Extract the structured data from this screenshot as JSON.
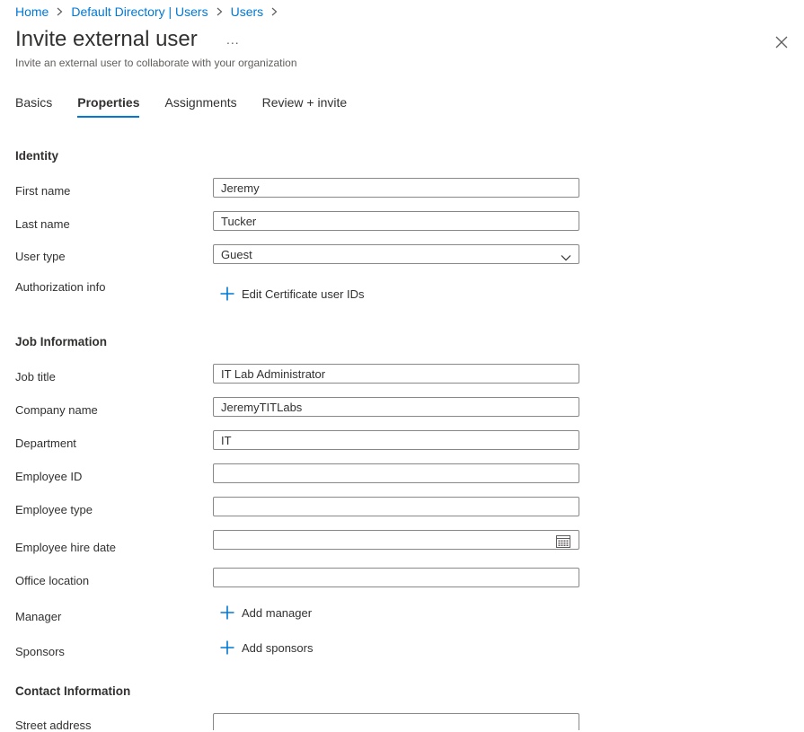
{
  "breadcrumb": {
    "items": [
      "Home",
      "Default Directory | Users",
      "Users"
    ]
  },
  "header": {
    "title": "Invite external user",
    "more_label": "...",
    "subtitle": "Invite an external user to collaborate with your organization"
  },
  "tabs": [
    {
      "label": "Basics",
      "active": false
    },
    {
      "label": "Properties",
      "active": true
    },
    {
      "label": "Assignments",
      "active": false
    },
    {
      "label": "Review + invite",
      "active": false
    }
  ],
  "identity": {
    "heading": "Identity",
    "first_name": {
      "label": "First name",
      "value": "Jeremy"
    },
    "last_name": {
      "label": "Last name",
      "value": "Tucker"
    },
    "user_type": {
      "label": "User type",
      "value": "Guest"
    },
    "authorization_info": {
      "label": "Authorization info",
      "action": "Edit Certificate user IDs"
    }
  },
  "job": {
    "heading": "Job Information",
    "job_title": {
      "label": "Job title",
      "value": "IT Lab Administrator"
    },
    "company_name": {
      "label": "Company name",
      "value": "JeremyTITLabs"
    },
    "department": {
      "label": "Department",
      "value": "IT"
    },
    "employee_id": {
      "label": "Employee ID",
      "value": ""
    },
    "employee_type": {
      "label": "Employee type",
      "value": ""
    },
    "hire_date": {
      "label": "Employee hire date",
      "value": ""
    },
    "office_location": {
      "label": "Office location",
      "value": ""
    },
    "manager": {
      "label": "Manager",
      "action": "Add manager"
    },
    "sponsors": {
      "label": "Sponsors",
      "action": "Add sponsors"
    }
  },
  "contact": {
    "heading": "Contact Information",
    "street_address": {
      "label": "Street address",
      "value": ""
    }
  },
  "colors": {
    "accent": "#0078d4",
    "text": "#323130",
    "border": "#8a8886"
  }
}
